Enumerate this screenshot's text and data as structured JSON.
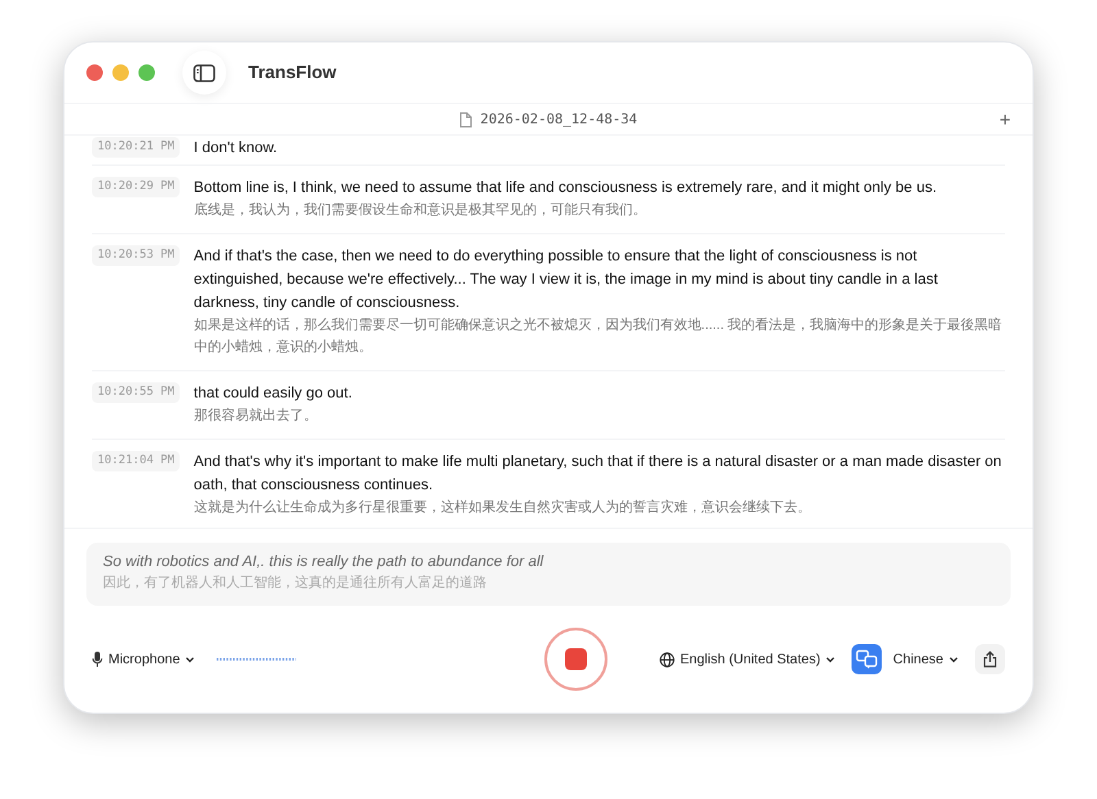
{
  "window": {
    "title": "TransFlow"
  },
  "session": {
    "file_name": "2026-02-08_12-48-34",
    "add_symbol": "+"
  },
  "transcript": [
    {
      "time": "10:20:21 PM",
      "text": "I don't know."
    },
    {
      "time": "10:20:29 PM",
      "text": "Bottom line is, I think, we need to assume that life and consciousness is extremely rare, and it might only be us.",
      "translation": "底线是，我认为，我们需要假设生命和意识是极其罕见的，可能只有我们。"
    },
    {
      "time": "10:20:53 PM",
      "text": "And if that's the case, then we need to do everything possible to ensure that the light of consciousness is not extinguished, because we're effectively... The way I view it is, the image in my mind is about tiny candle in a last darkness, tiny candle of consciousness.",
      "translation": "如果是这样的话，那么我们需要尽一切可能确保意识之光不被熄灭，因为我们有效地...... 我的看法是，我脑海中的形象是关于最後黑暗中的小蜡烛，意识的小蜡烛。"
    },
    {
      "time": "10:20:55 PM",
      "text": "that could easily go out.",
      "translation": "那很容易就出去了。"
    },
    {
      "time": "10:21:04 PM",
      "text": "And that's why it's important to make life multi planetary, such that if there is a natural disaster or a man made disaster on oath, that consciousness continues.",
      "translation": "这就是为什么让生命成为多行星很重要，这样如果发生自然灾害或人为的誓言灾难，意识会继续下去。"
    }
  ],
  "live": {
    "text": "So with robotics and AI,. this is really the path to abundance for all",
    "translation": "因此，有了机器人和人工智能，这真的是通往所有人富足的道路"
  },
  "controls": {
    "input_device": "Microphone",
    "recording": true,
    "source_language": "English (United States)",
    "target_language": "Chinese"
  }
}
